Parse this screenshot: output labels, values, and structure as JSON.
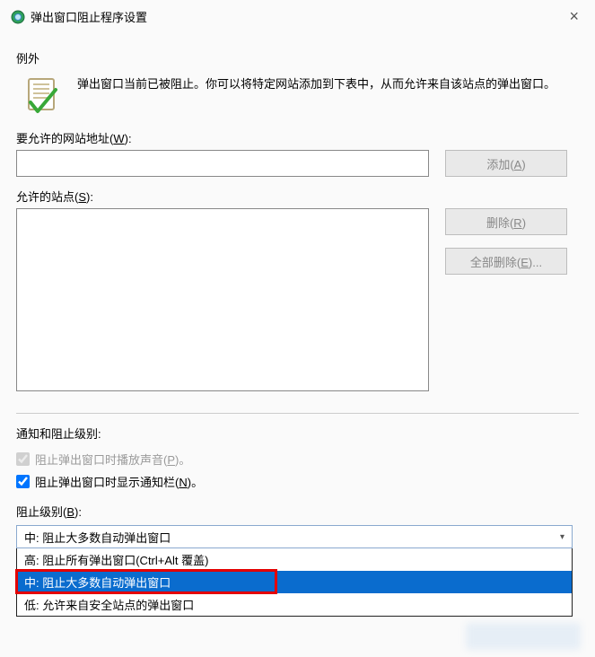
{
  "window": {
    "title": "弹出窗口阻止程序设置",
    "close": "×"
  },
  "exceptions": {
    "heading": "例外",
    "description": "弹出窗口当前已被阻止。你可以将特定网站添加到下表中，从而允许来自该站点的弹出窗口。",
    "website_label_prefix": "要允许的网站地址(",
    "website_label_key": "W",
    "website_label_suffix": "):",
    "add_btn_prefix": "添加(",
    "add_btn_key": "A",
    "add_btn_suffix": ")",
    "allowed_label_prefix": "允许的站点(",
    "allowed_label_key": "S",
    "allowed_label_suffix": "):",
    "remove_btn_prefix": "删除(",
    "remove_btn_key": "R",
    "remove_btn_suffix": ")",
    "remove_all_btn_prefix": "全部删除(",
    "remove_all_btn_key": "E",
    "remove_all_btn_suffix": ")..."
  },
  "notify": {
    "heading": "通知和阻止级别:",
    "sound_prefix": "阻止弹出窗口时播放声音(",
    "sound_key": "P",
    "sound_suffix": ")。",
    "bar_prefix": "阻止弹出窗口时显示通知栏(",
    "bar_key": "N",
    "bar_suffix": ")。",
    "level_label_prefix": "阻止级别(",
    "level_label_key": "B",
    "level_label_suffix": "):"
  },
  "combo": {
    "selected": "中: 阻止大多数自动弹出窗口",
    "options": [
      "高: 阻止所有弹出窗口(Ctrl+Alt 覆盖)",
      "中: 阻止大多数自动弹出窗口",
      "低: 允许来自安全站点的弹出窗口"
    ]
  }
}
